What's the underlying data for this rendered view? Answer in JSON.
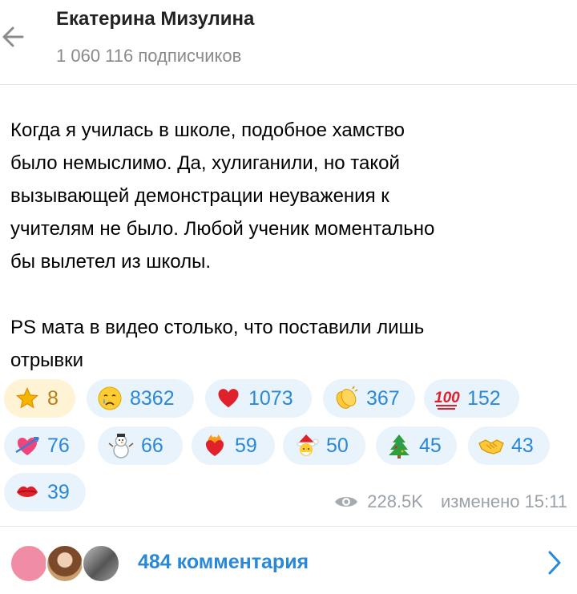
{
  "header": {
    "title": "Екатерина Мизулина",
    "subtitle": "1 060 116 подписчиков"
  },
  "message": {
    "text": "Когда я училась в школе, подобное хамство\nбыло немыслимо. Да, хулиганили, но такой\nвызывающей демонстрации неуважения к\nучителям не было. Любой ученик моментально\nбы вылетел из школы.\n\nPS мата в видео столько, что поставили лишь\nотрывки",
    "reactions": [
      {
        "emoji": "star",
        "count": "8"
      },
      {
        "emoji": "crying-face",
        "count": "8362"
      },
      {
        "emoji": "red-heart",
        "count": "1073"
      },
      {
        "emoji": "clapping-hands",
        "count": "367"
      },
      {
        "emoji": "hundred-points",
        "count": "152"
      },
      {
        "emoji": "heart-with-arrow",
        "count": "76"
      },
      {
        "emoji": "snowman",
        "count": "66"
      },
      {
        "emoji": "heart-on-fire",
        "count": "59"
      },
      {
        "emoji": "santa-claus",
        "count": "50"
      },
      {
        "emoji": "christmas-tree",
        "count": "45"
      },
      {
        "emoji": "handshake",
        "count": "43"
      },
      {
        "emoji": "kiss-mark",
        "count": "39"
      }
    ],
    "views": "228.5K",
    "edited": "изменено 15:11"
  },
  "comments": {
    "label": "484 комментария"
  },
  "colors": {
    "accent": "#2a88d8",
    "reaction_bg": "#e9f3fc",
    "chosen_reaction_bg": "#fff3d6",
    "muted_text": "#8a8a8a"
  }
}
